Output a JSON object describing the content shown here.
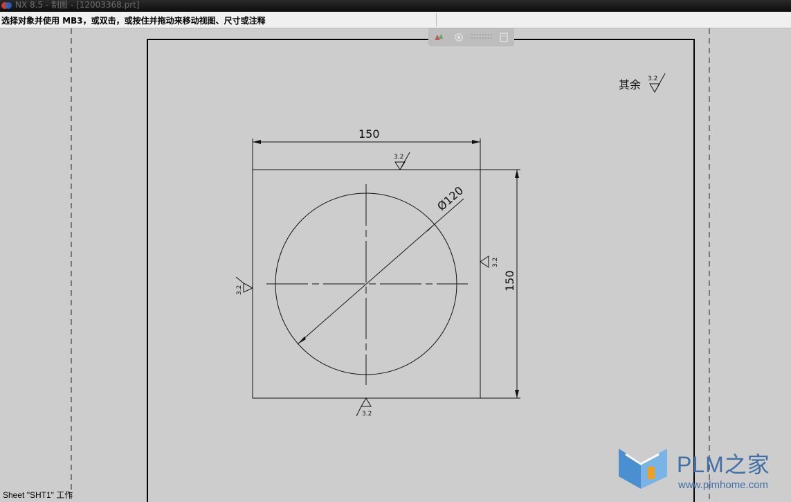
{
  "window": {
    "title": "NX 8.5 - 制图 - [12003368.prt]"
  },
  "statusbar": {
    "prompt": "选择对象并使用 MB3，或双击，或按住并拖动来移动视图、尺寸或注释"
  },
  "drawing": {
    "note_label": "其余",
    "dimensions": {
      "width_label": "150",
      "height_label": "150",
      "diameter_label": "Ø120"
    },
    "roughness": {
      "value": "3.2"
    }
  },
  "view_toolbar": {
    "icons": [
      "view-color-icon",
      "gear-icon",
      "grid-icon",
      "sheet-icon"
    ]
  },
  "sheet_status": {
    "text": "Sheet \"SHT1\" 工作"
  },
  "watermark": {
    "name": "PLM之家",
    "url": "www.plmhome.com",
    "color": "#3f6fa6"
  }
}
